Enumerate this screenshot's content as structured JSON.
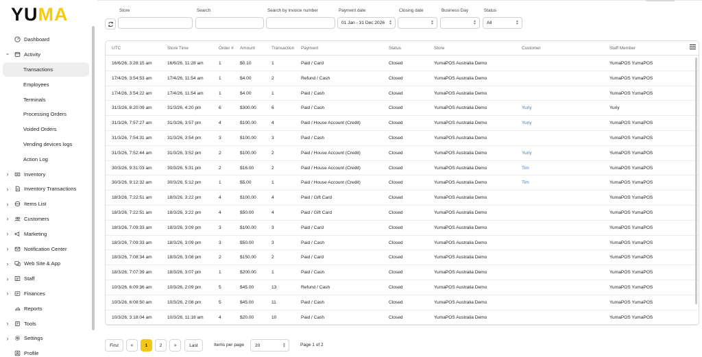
{
  "brand": {
    "logo_left": "YU",
    "logo_right": "MA",
    "accent_color": "#f5c518"
  },
  "sidebar": {
    "items": [
      {
        "label": "Dashboard",
        "icon": "dashboard-icon",
        "level": 0,
        "expandable": false
      },
      {
        "label": "Activity",
        "icon": "activity-icon",
        "level": 0,
        "expandable": true,
        "expanded": true
      },
      {
        "label": "Transactions",
        "level": 1,
        "active": true
      },
      {
        "label": "Employees",
        "level": 1
      },
      {
        "label": "Terminals",
        "level": 1
      },
      {
        "label": "Processing Orders",
        "level": 1
      },
      {
        "label": "Voided Orders",
        "level": 1
      },
      {
        "label": "Vending devices logs",
        "level": 1
      },
      {
        "label": "Action Log",
        "level": 1
      },
      {
        "label": "Inventory",
        "icon": "inventory-icon",
        "level": 0,
        "expandable": true
      },
      {
        "label": "Inventory Transactions",
        "icon": "document-icon",
        "level": 0,
        "expandable": true
      },
      {
        "label": "Items List",
        "icon": "items-icon",
        "level": 0,
        "expandable": true
      },
      {
        "label": "Customers",
        "icon": "customers-icon",
        "level": 0,
        "expandable": true
      },
      {
        "label": "Marketing",
        "icon": "marketing-icon",
        "level": 0,
        "expandable": true
      },
      {
        "label": "Notification Center",
        "icon": "mail-icon",
        "level": 0,
        "expandable": true
      },
      {
        "label": "Web Site & App",
        "icon": "devices-icon",
        "level": 0,
        "expandable": true
      },
      {
        "label": "Staff",
        "icon": "staff-icon",
        "level": 0,
        "expandable": true
      },
      {
        "label": "Finances",
        "icon": "finances-icon",
        "level": 0,
        "expandable": true
      },
      {
        "label": "Reports",
        "icon": "reports-icon",
        "level": 0,
        "expandable": false
      },
      {
        "label": "Tools",
        "icon": "tools-icon",
        "level": 0,
        "expandable": true
      },
      {
        "label": "Settings",
        "icon": "settings-icon",
        "level": 0,
        "expandable": true
      },
      {
        "label": "Profile",
        "icon": "profile-icon",
        "level": 0,
        "expandable": false
      }
    ]
  },
  "filters": {
    "store": {
      "label": "Store",
      "value": ""
    },
    "search": {
      "label": "Search",
      "value": ""
    },
    "invoice": {
      "label": "Search by invoice number",
      "value": ""
    },
    "payment_date": {
      "label": "Payment date",
      "value": "01 Jan - 31 Dec 2026"
    },
    "closing_date": {
      "label": "Closing date",
      "value": ""
    },
    "business_day": {
      "label": "Business Day",
      "value": ""
    },
    "status": {
      "label": "Status",
      "value": "All"
    }
  },
  "table": {
    "columns": [
      "UTC",
      "Store Time",
      "Order #",
      "Amount",
      "Transaction",
      "Payment",
      "Status",
      "Store",
      "Customer",
      "Staff Member"
    ],
    "rows": [
      [
        "16/6/26, 3:28:15 am",
        "16/6/26, 11:28 am",
        "1",
        "$0.10",
        "1",
        "Paid / Card",
        "Closed",
        "YumaPOS Australia Demo",
        "",
        "YumaPOS YumaPOS"
      ],
      [
        "17/4/26, 3:54:53 am",
        "17/4/26, 11:54 am",
        "1",
        "$4.00",
        "2",
        "Refund / Cash",
        "Closed",
        "YumaPOS Australia Demo",
        "",
        "YumaPOS YumaPOS"
      ],
      [
        "17/4/26, 3:54:22 am",
        "17/4/26, 11:54 am",
        "1",
        "$4.00",
        "1",
        "Paid / Cash",
        "Closed",
        "YumaPOS Australia Demo",
        "",
        "YumaPOS YumaPOS"
      ],
      [
        "31/3/26, 8:20:09 am",
        "31/3/26, 4:20 pm",
        "6",
        "$300.00",
        "6",
        "Paid / Cash",
        "Closed",
        "YumaPOS Australia Demo",
        "Yuriy",
        "Yuriy"
      ],
      [
        "31/3/26, 7:57:27 am",
        "31/3/26, 3:57 pm",
        "4",
        "$100.00",
        "4",
        "Paid / House Account (Credit)",
        "Closed",
        "YumaPOS Australia Demo",
        "Yuriy",
        "YumaPOS YumaPOS"
      ],
      [
        "31/3/26, 7:54:31 am",
        "31/3/26, 3:54 pm",
        "3",
        "$100.00",
        "3",
        "Paid / Cash",
        "Closed",
        "YumaPOS Australia Demo",
        "",
        "YumaPOS YumaPOS"
      ],
      [
        "31/3/26, 7:52:44 am",
        "31/3/26, 3:52 pm",
        "2",
        "$100.00",
        "2",
        "Paid / House Account (Credit)",
        "Closed",
        "YumaPOS Australia Demo",
        "Yuriy",
        "YumaPOS YumaPOS"
      ],
      [
        "30/3/26, 9:31:03 am",
        "30/3/26, 5:31 pm",
        "2",
        "$16.00",
        "2",
        "Paid / House Account (Credit)",
        "Closed",
        "YumaPOS Australia Demo",
        "Tim",
        "YumaPOS YumaPOS"
      ],
      [
        "30/3/26, 9:12:32 am",
        "30/3/26, 5:12 pm",
        "1",
        "$5.00",
        "1",
        "Paid / House Account (Credit)",
        "Closed",
        "YumaPOS Australia Demo",
        "Tim",
        "YumaPOS YumaPOS"
      ],
      [
        "18/3/26, 7:22:51 am",
        "18/3/26, 3:22 pm",
        "4",
        "$100.00",
        "4",
        "Paid / Gift Card",
        "Closed",
        "YumaPOS Australia Demo",
        "",
        "YumaPOS YumaPOS"
      ],
      [
        "18/3/26, 7:22:51 am",
        "18/3/26, 3:22 pm",
        "4",
        "$50.00",
        "4",
        "Paid / Gift Card",
        "Closed",
        "YumaPOS Australia Demo",
        "",
        "YumaPOS YumaPOS"
      ],
      [
        "18/3/26, 7:09:33 am",
        "18/3/26, 3:09 pm",
        "3",
        "$100.00",
        "3",
        "Paid / Card",
        "Closed",
        "YumaPOS Australia Demo",
        "",
        "YumaPOS YumaPOS"
      ],
      [
        "18/3/26, 7:09:33 am",
        "18/3/26, 3:09 pm",
        "3",
        "$50.00",
        "3",
        "Paid / Cash",
        "Closed",
        "YumaPOS Australia Demo",
        "",
        "YumaPOS YumaPOS"
      ],
      [
        "18/3/26, 7:08:34 am",
        "18/3/26, 3:08 pm",
        "2",
        "$150.00",
        "2",
        "Paid / Card",
        "Closed",
        "YumaPOS Australia Demo",
        "",
        "YumaPOS YumaPOS"
      ],
      [
        "18/3/26, 7:07:39 am",
        "18/3/26, 3:07 pm",
        "1",
        "$200.00",
        "1",
        "Paid / Cash",
        "Closed",
        "YumaPOS Australia Demo",
        "",
        "YumaPOS YumaPOS"
      ],
      [
        "10/3/26, 6:09:36 am",
        "10/3/26, 2:09 pm",
        "5",
        "$45.00",
        "13",
        "Refund / Cash",
        "Closed",
        "YumaPOS Australia Demo",
        "",
        "YumaPOS YumaPOS"
      ],
      [
        "10/3/26, 6:08:50 am",
        "10/3/26, 2:08 pm",
        "5",
        "$45.00",
        "11",
        "Paid / Cash",
        "Closed",
        "YumaPOS Australia Demo",
        "",
        "YumaPOS YumaPOS"
      ],
      [
        "10/3/26, 3:18:04 am",
        "10/3/26, 11:18 am",
        "4",
        "$20.00",
        "10",
        "Paid / Cash",
        "Closed",
        "YumaPOS Australia Demo",
        "",
        "YumaPOS YumaPOS"
      ]
    ]
  },
  "pagination": {
    "first_label": "First",
    "prev_label": "<",
    "pages": [
      "1",
      "2"
    ],
    "current_page": "1",
    "next_label": ">",
    "last_label": "Last",
    "items_per_page_label": "Items per page",
    "items_per_page_value": "20",
    "page_info": "Page 1 of 2"
  }
}
